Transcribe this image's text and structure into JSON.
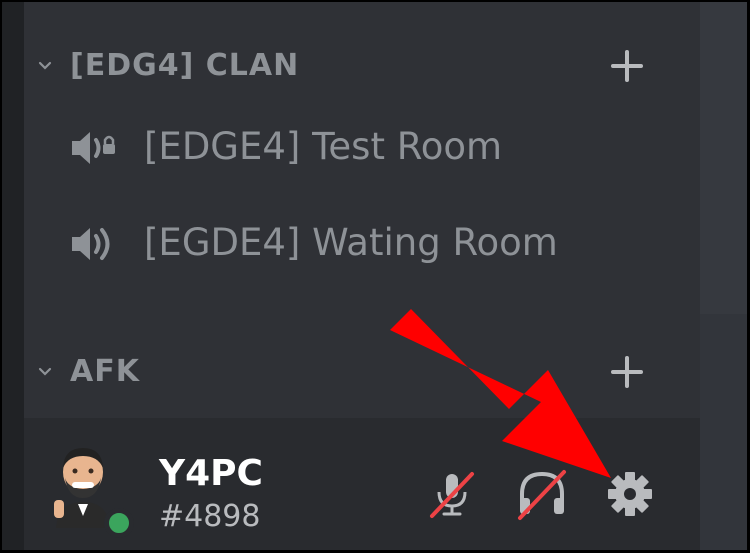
{
  "categories": [
    {
      "label": "[EDG4] CLAN"
    },
    {
      "label": "AFK"
    }
  ],
  "channels": [
    {
      "name": "[EDGE4] Test Room",
      "icon": "speaker-locked-icon"
    },
    {
      "name": "[EGDE4] Wating Room",
      "icon": "speaker-icon"
    }
  ],
  "user": {
    "username": "Y4PC",
    "discriminator": "#4898",
    "status": "online"
  },
  "controls": {
    "mute": "microphone-muted-icon",
    "deafen": "headphones-deafened-icon",
    "settings": "gear-icon"
  },
  "colors": {
    "background": "#2f3136",
    "panel": "#292b2f",
    "text_muted": "#8e9297",
    "status_online": "#3ba55d",
    "strike": "#ed4245",
    "arrow": "#ff0000"
  }
}
